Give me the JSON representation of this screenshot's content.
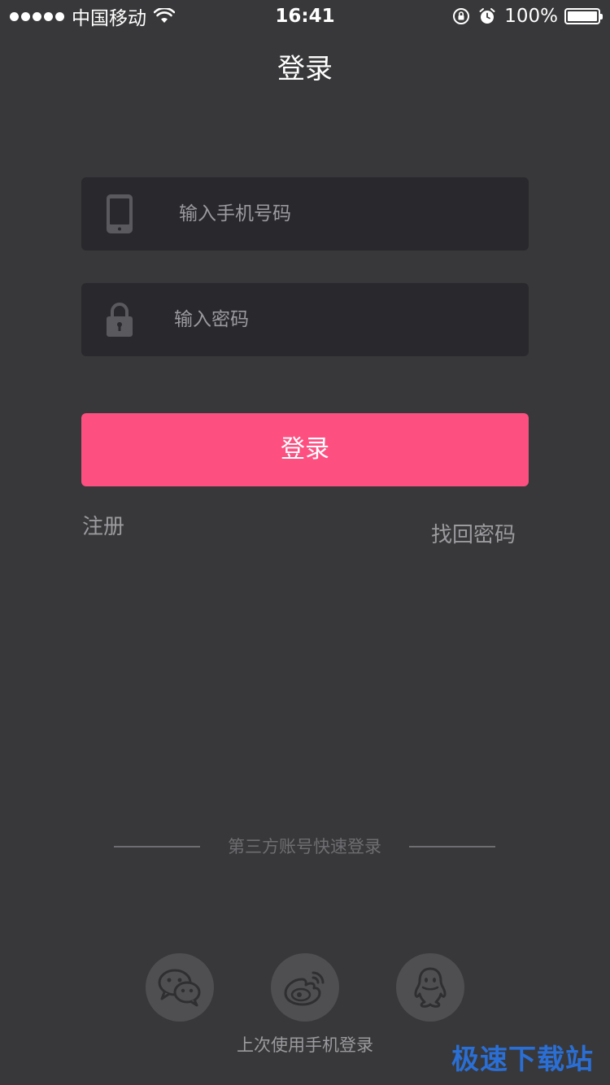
{
  "status_bar": {
    "carrier": "中国移动",
    "time": "16:41",
    "battery": "100%"
  },
  "nav": {
    "title": "登录"
  },
  "form": {
    "phone_placeholder": "输入手机号码",
    "password_placeholder": "输入密码",
    "login_label": "登录",
    "register_label": "注册",
    "forgot_label": "找回密码"
  },
  "third_party": {
    "divider_text": "第三方账号快速登录",
    "providers": [
      "wechat-icon",
      "weibo-icon",
      "qq-icon"
    ],
    "last_login_text": "上次使用手机登录"
  },
  "watermark": "极速下载站",
  "colors": {
    "background": "#38383a",
    "field": "#29282d",
    "accent": "#fe4f81",
    "muted_text": "#9b9b9f",
    "social_bg": "#4f4f52",
    "watermark": "#2a6fd6"
  }
}
